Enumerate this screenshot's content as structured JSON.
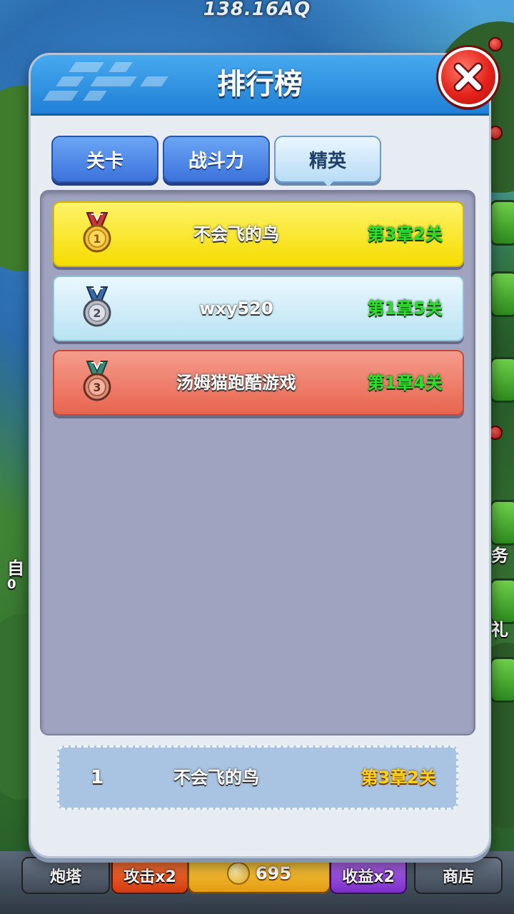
{
  "background": {
    "top_value": "138.16AQ",
    "left_labels": [
      "自",
      "0"
    ],
    "right_labels": [
      "务",
      "礼"
    ],
    "bottom_bar": {
      "turret": "炮塔",
      "attack": "攻击x2",
      "coins": "695",
      "income": "收益x2",
      "shop": "商店"
    }
  },
  "modal": {
    "title": "排行榜",
    "tabs": [
      {
        "label": "关卡",
        "active": false
      },
      {
        "label": "战斗力",
        "active": false
      },
      {
        "label": "精英",
        "active": true
      }
    ],
    "rows": [
      {
        "rank": "1",
        "name": "不会飞的鸟",
        "progress": "第3章2关",
        "medal": "gold"
      },
      {
        "rank": "2",
        "name": "wxy520",
        "progress": "第1章5关",
        "medal": "silver"
      },
      {
        "rank": "3",
        "name": "汤姆猫跑酷游戏",
        "progress": "第1章4关",
        "medal": "bronze"
      }
    ],
    "my_rank": {
      "rank": "1",
      "name": "不会飞的鸟",
      "progress": "第3章2关"
    }
  },
  "colors": {
    "header_blue": "#2a8fe0",
    "gold_row": "#f8e420",
    "silver_row": "#d2eef8",
    "bronze_row": "#ee7a66",
    "progress_green": "#2ce02c",
    "my_progress_yellow": "#ffd21e"
  }
}
